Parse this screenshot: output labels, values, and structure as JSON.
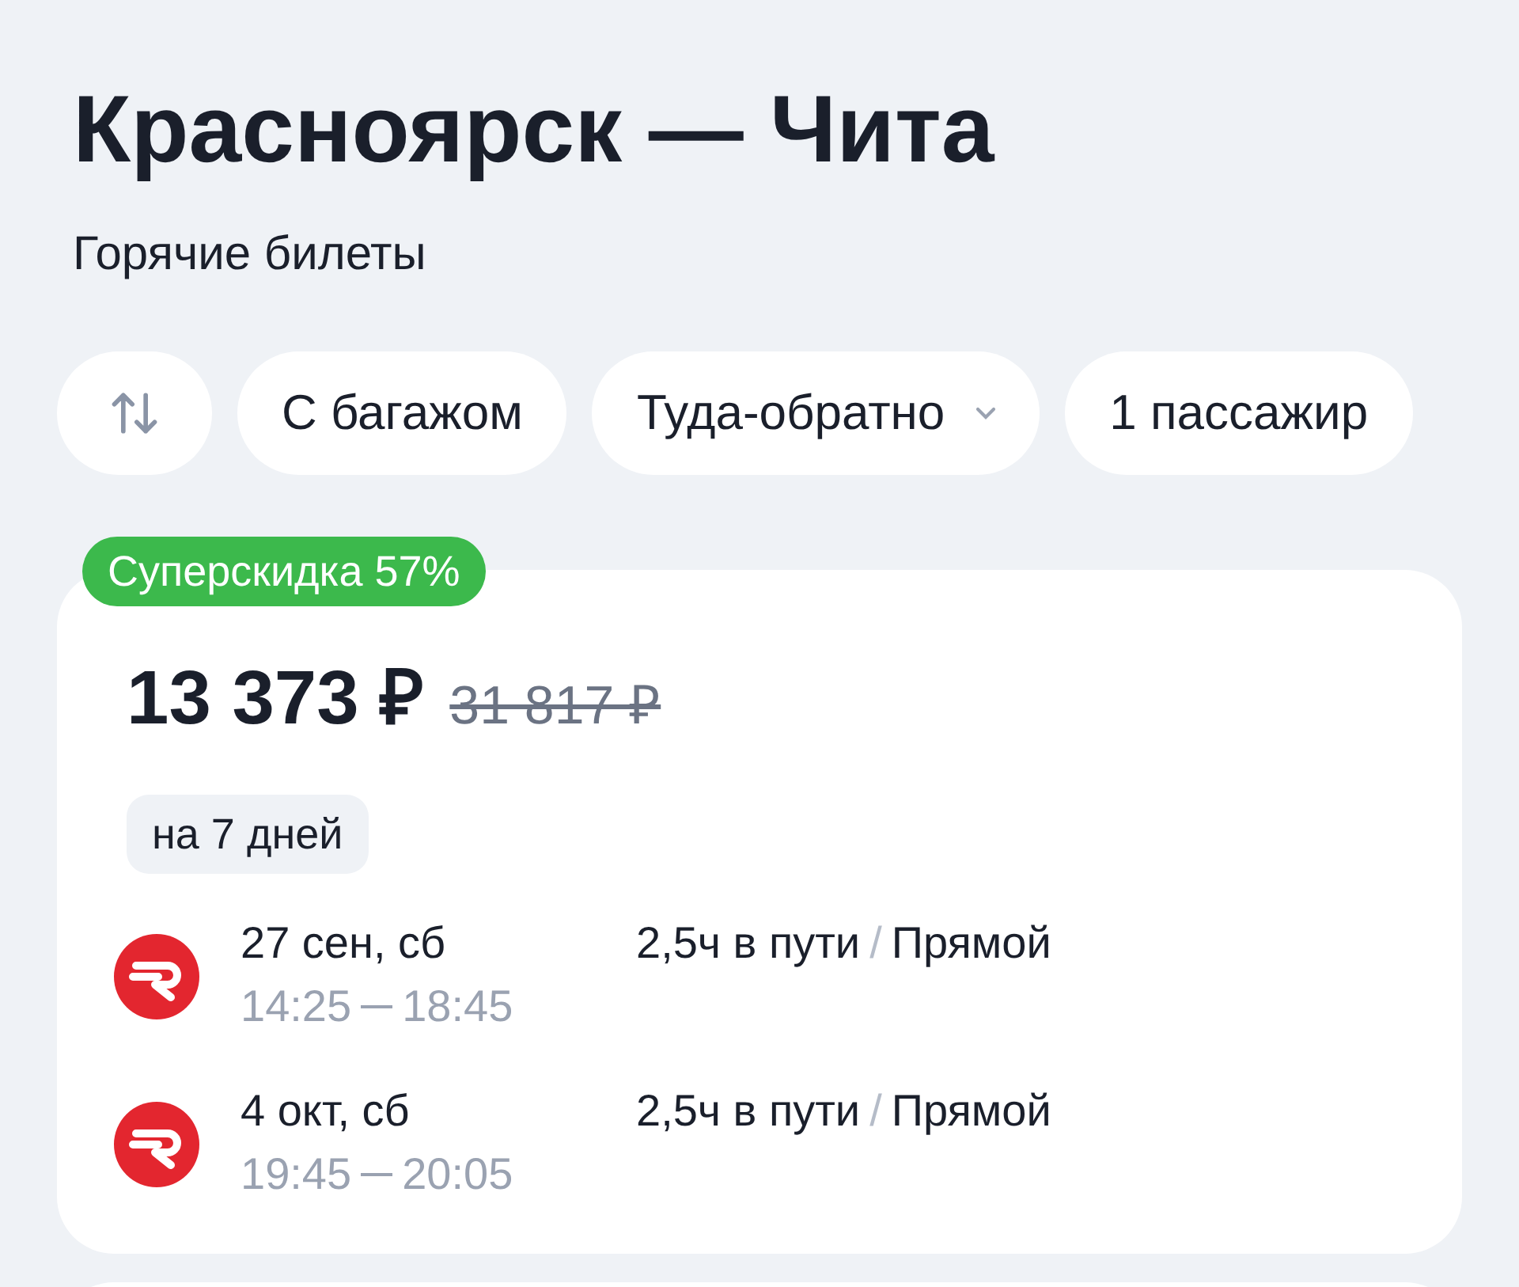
{
  "title": "Красноярск — Чита",
  "subtitle": "Горячие билеты",
  "chips": [
    {
      "kind": "swap"
    },
    {
      "kind": "text",
      "label": "С багажом"
    },
    {
      "kind": "dropdown",
      "label": "Туда-обратно"
    },
    {
      "kind": "text",
      "label": "1 пассажир"
    }
  ],
  "offer": {
    "badge": "Суперскидка 57%",
    "price": "13 373 ₽",
    "old_price": "31 817 ₽",
    "stay": "на 7 дней",
    "flights": [
      {
        "date": "27 сен, сб",
        "departure": "14:25",
        "arrival": "18:45",
        "duration": "2,5ч в пути",
        "separator": "/",
        "type": "Прямой"
      },
      {
        "date": "4 окт, сб",
        "departure": "19:45",
        "arrival": "20:05",
        "duration": "2,5ч в пути",
        "separator": "/",
        "type": "Прямой"
      }
    ]
  }
}
